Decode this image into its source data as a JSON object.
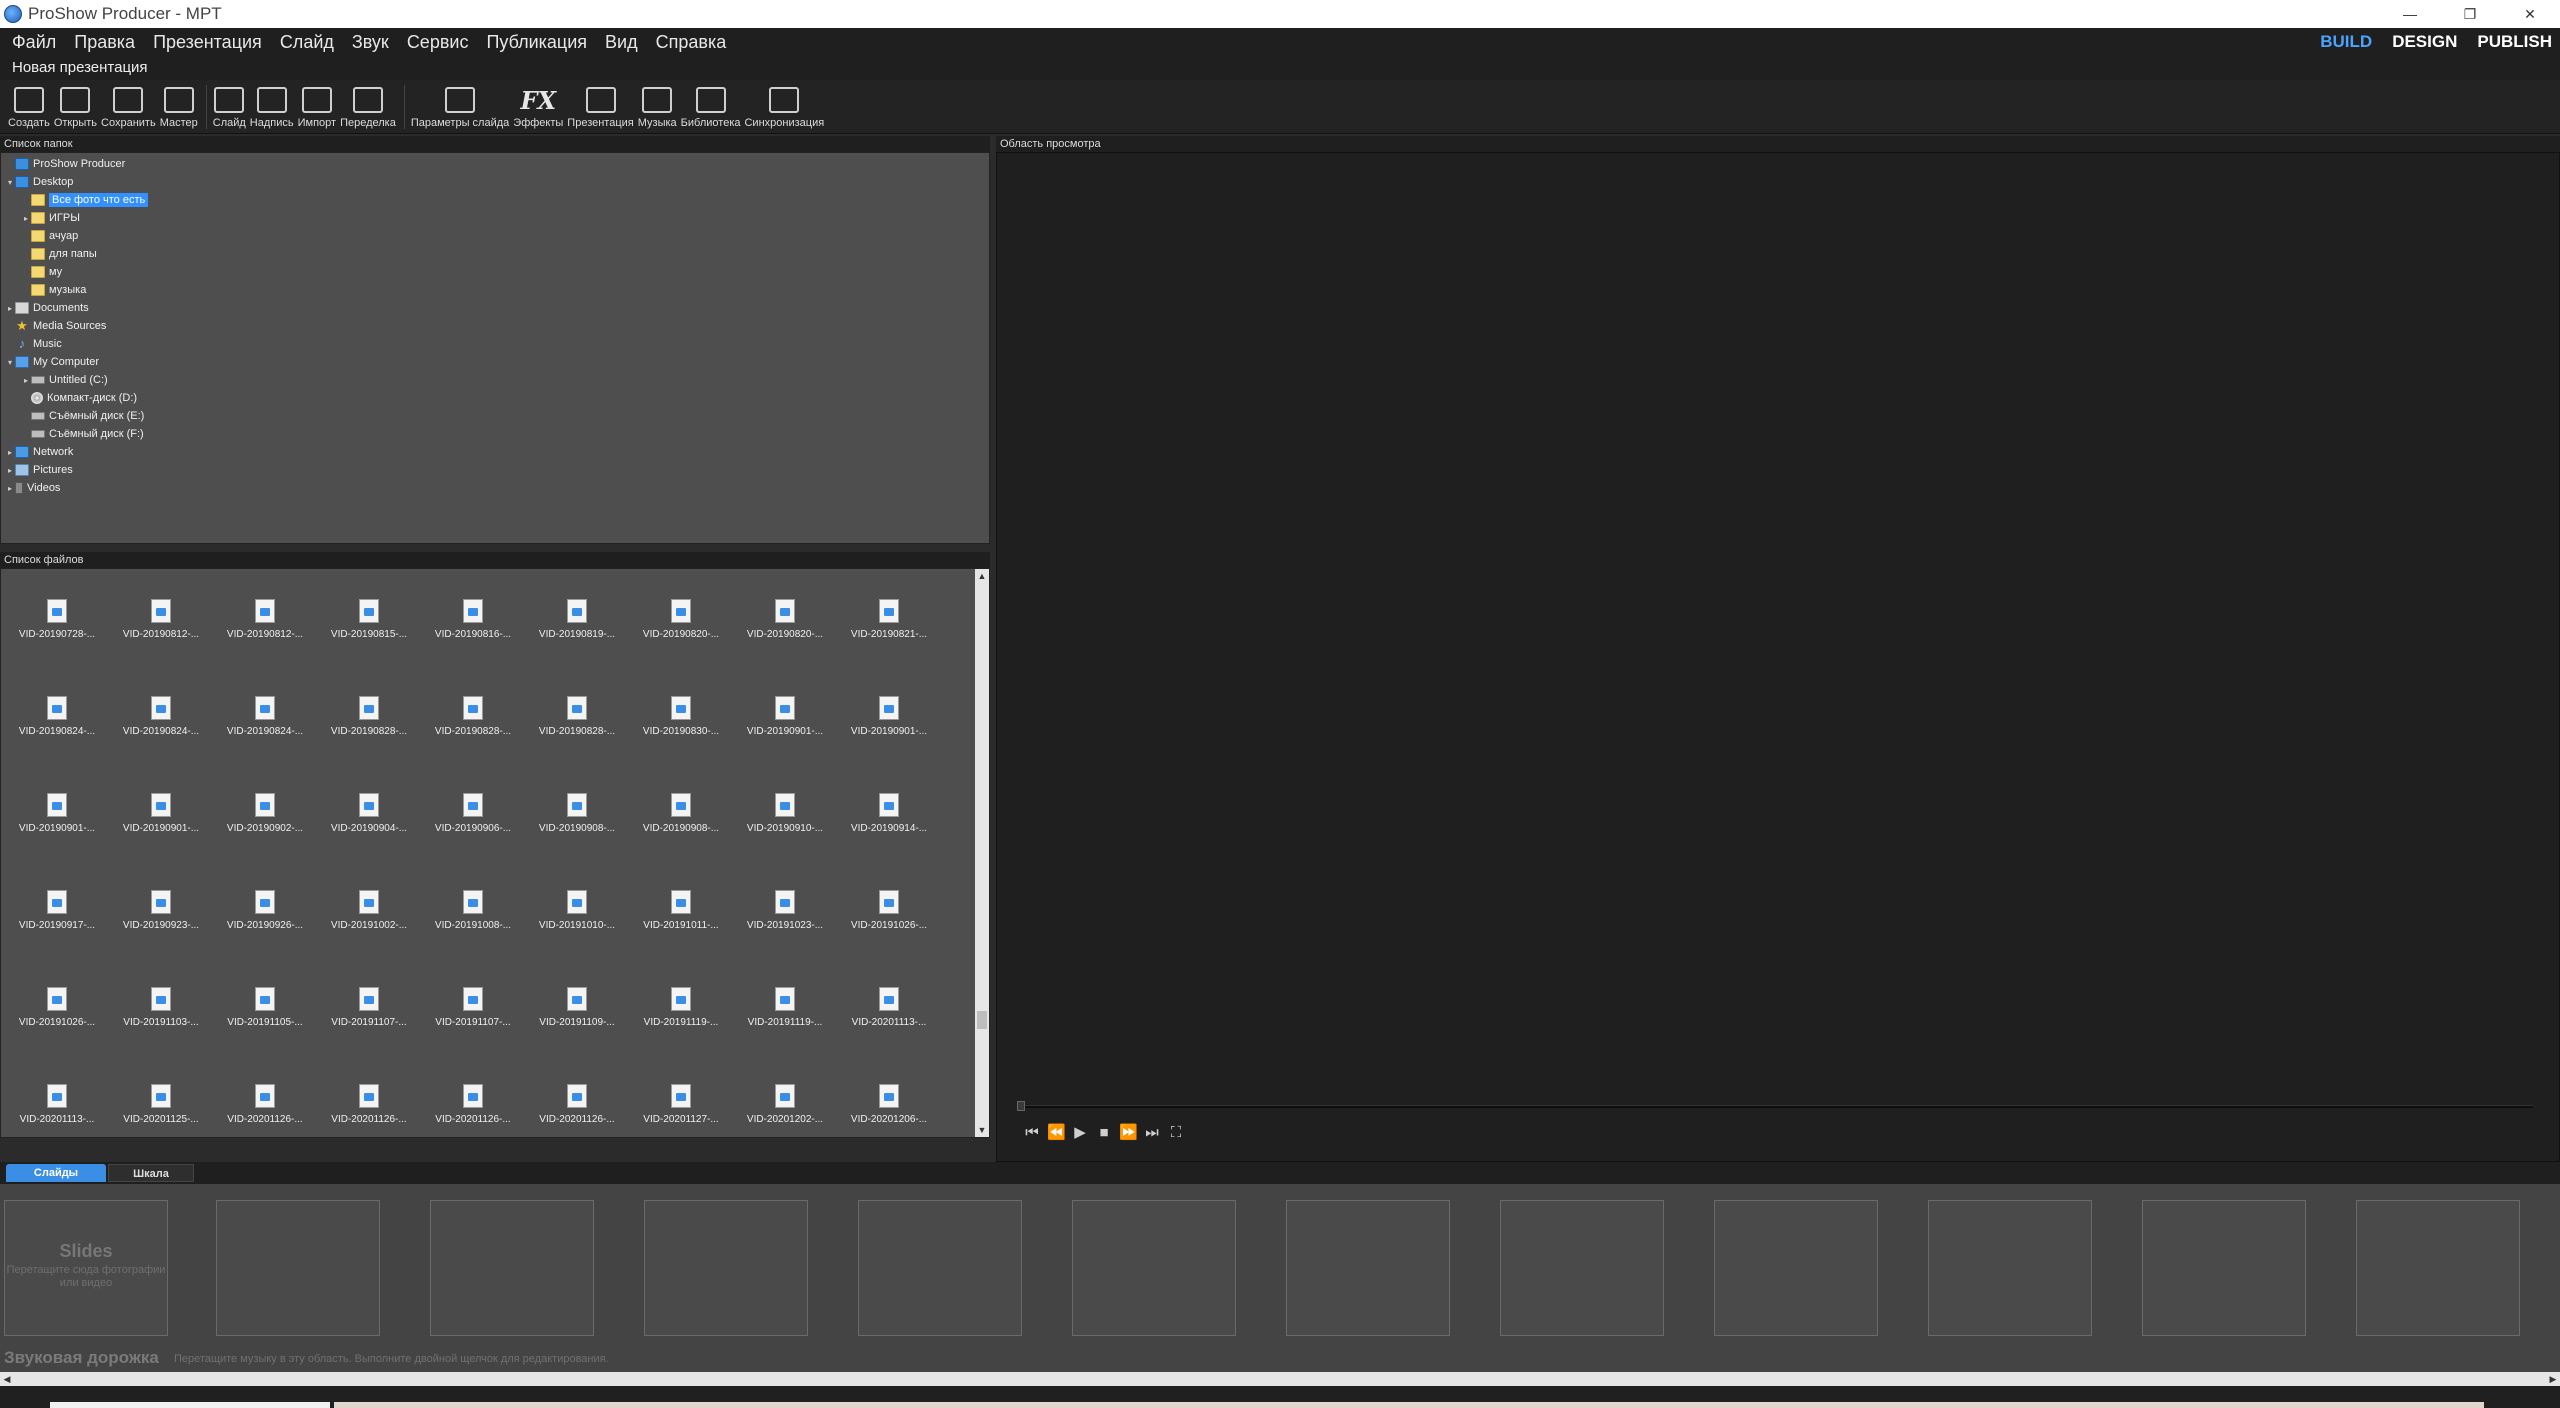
{
  "window": {
    "title": "ProShow Producer - MPT",
    "controls": [
      "—",
      "❐",
      "✕"
    ]
  },
  "menu": [
    "Файл",
    "Правка",
    "Презентация",
    "Слайд",
    "Звук",
    "Сервис",
    "Публикация",
    "Вид",
    "Справка"
  ],
  "modes": [
    "BUILD",
    "DESIGN",
    "PUBLISH"
  ],
  "active_mode": "BUILD",
  "doc_title": "Новая презентация",
  "toolbar": [
    {
      "label": "Создать",
      "icon": "create-icon"
    },
    {
      "label": "Открыть",
      "icon": "open-folder-icon"
    },
    {
      "label": "Сохранить",
      "icon": "save-icon"
    },
    {
      "label": "Мастер",
      "icon": "wizard-icon"
    },
    {
      "label": "Слайд",
      "icon": "slide-icon"
    },
    {
      "label": "Надпись",
      "icon": "caption-icon"
    },
    {
      "label": "Импорт",
      "icon": "import-icon"
    },
    {
      "label": "Переделка",
      "icon": "remix-icon"
    },
    {
      "label": "Параметры слайда",
      "icon": "slide-options-icon"
    },
    {
      "label": "Эффекты",
      "icon": "fx-icon"
    },
    {
      "label": "Презентация",
      "icon": "show-icon"
    },
    {
      "label": "Музыка",
      "icon": "music-icon"
    },
    {
      "label": "Библиотека",
      "icon": "library-icon"
    },
    {
      "label": "Синхронизация",
      "icon": "sync-icon"
    }
  ],
  "folder_panel": {
    "title": "Список папок",
    "tree": [
      {
        "label": "ProShow Producer",
        "icon": "proshow-icon",
        "level": 0,
        "arrow": ""
      },
      {
        "label": "Desktop",
        "icon": "desktop-icon",
        "level": 0,
        "arrow": "▾"
      },
      {
        "label": "Все фото что есть",
        "icon": "folder-icon",
        "level": 1,
        "arrow": "",
        "selected": true
      },
      {
        "label": "ИГРЫ",
        "icon": "folder-icon",
        "level": 1,
        "arrow": "▸"
      },
      {
        "label": "ачуар",
        "icon": "folder-icon",
        "level": 1,
        "arrow": ""
      },
      {
        "label": "для папы",
        "icon": "folder-icon",
        "level": 1,
        "arrow": ""
      },
      {
        "label": "му",
        "icon": "folder-icon",
        "level": 1,
        "arrow": ""
      },
      {
        "label": "музыка",
        "icon": "folder-icon",
        "level": 1,
        "arrow": ""
      },
      {
        "label": "Documents",
        "icon": "documents-icon",
        "level": 0,
        "arrow": "▸"
      },
      {
        "label": "Media Sources",
        "icon": "star-icon",
        "level": 0,
        "arrow": ""
      },
      {
        "label": "Music",
        "icon": "music-note-icon",
        "level": 0,
        "arrow": ""
      },
      {
        "label": "My Computer",
        "icon": "computer-icon",
        "level": 0,
        "arrow": "▾"
      },
      {
        "label": "Untitled (C:)",
        "icon": "drive-icon",
        "level": 1,
        "arrow": "▸"
      },
      {
        "label": "Компакт-диск (D:)",
        "icon": "cd-icon",
        "level": 1,
        "arrow": ""
      },
      {
        "label": "Съёмный диск (E:)",
        "icon": "drive-icon",
        "level": 1,
        "arrow": ""
      },
      {
        "label": "Съёмный диск (F:)",
        "icon": "drive-icon",
        "level": 1,
        "arrow": ""
      },
      {
        "label": "Network",
        "icon": "network-icon",
        "level": 0,
        "arrow": "▸"
      },
      {
        "label": "Pictures",
        "icon": "pictures-icon",
        "level": 0,
        "arrow": "▸"
      },
      {
        "label": "Videos",
        "icon": "videos-icon",
        "level": 0,
        "arrow": "▸"
      }
    ]
  },
  "file_panel": {
    "title": "Список файлов",
    "files": [
      "VID-20190728-...",
      "VID-20190812-...",
      "VID-20190812-...",
      "VID-20190815-...",
      "VID-20190816-...",
      "VID-20190819-...",
      "VID-20190820-...",
      "VID-20190820-...",
      "VID-20190821-...",
      "VID-20190824-...",
      "VID-20190824-...",
      "VID-20190824-...",
      "VID-20190828-...",
      "VID-20190828-...",
      "VID-20190828-...",
      "VID-20190830-...",
      "VID-20190901-...",
      "VID-20190901-...",
      "VID-20190901-...",
      "VID-20190901-...",
      "VID-20190902-...",
      "VID-20190904-...",
      "VID-20190906-...",
      "VID-20190908-...",
      "VID-20190908-...",
      "VID-20190910-...",
      "VID-20190914-...",
      "VID-20190917-...",
      "VID-20190923-...",
      "VID-20190926-...",
      "VID-20191002-...",
      "VID-20191008-...",
      "VID-20191010-...",
      "VID-20191011-...",
      "VID-20191023-...",
      "VID-20191026-...",
      "VID-20191026-...",
      "VID-20191103-...",
      "VID-20191105-...",
      "VID-20191107-...",
      "VID-20191107-...",
      "VID-20191109-...",
      "VID-20191119-...",
      "VID-20191119-...",
      "VID-20201113-...",
      "VID-20201113-...",
      "VID-20201125-...",
      "VID-20201126-...",
      "VID-20201126-...",
      "VID-20201126-...",
      "VID-20201126-...",
      "VID-20201127-...",
      "VID-20201202-...",
      "VID-20201206-..."
    ]
  },
  "preview_panel": {
    "title": "Область просмотра",
    "transport": [
      "⏮",
      "⏪",
      "▶",
      "■",
      "⏩",
      "⏭",
      "⛶"
    ]
  },
  "bottom_tabs": [
    "Слайды",
    "Шкала"
  ],
  "active_bottom_tab": "Слайды",
  "slides": {
    "placeholder_title": "Slides",
    "placeholder_hint": "Перетащите сюда фотографии или видео",
    "empty_slots": 11
  },
  "soundtrack": {
    "title": "Звуковая дорожка",
    "hint": "Перетащите музыку в эту область. Выполните двойной щелчок для редактирования."
  },
  "colors": {
    "accent": "#3a8ee6",
    "panel_bg": "#4e4e4e",
    "dark_bg": "#1f1f1f"
  }
}
